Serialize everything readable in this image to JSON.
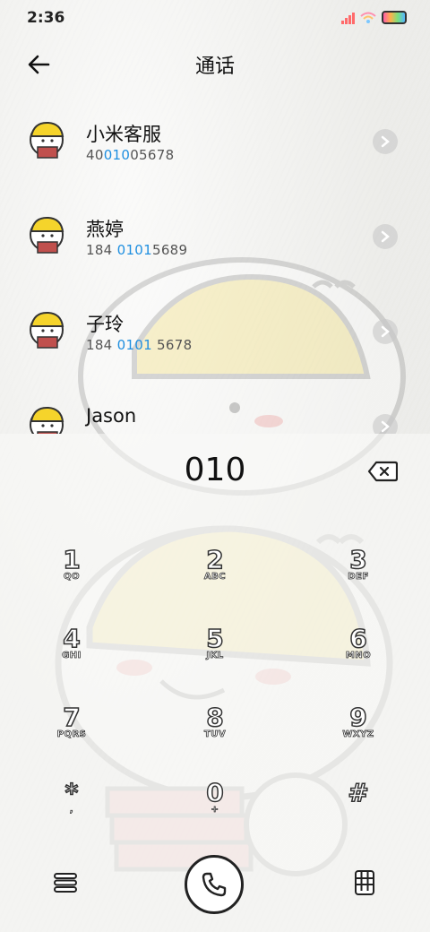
{
  "status": {
    "time": "2:36"
  },
  "header": {
    "title": "通话"
  },
  "contacts": [
    {
      "name": "小米客服",
      "num_pre": "40",
      "num_hl": "010",
      "num_post": "05678"
    },
    {
      "name": "燕婷",
      "num_pre": "184 ",
      "num_hl": "0101",
      "num_post": "5689"
    },
    {
      "name": "子玲",
      "num_pre": "184 ",
      "num_hl": "0101",
      "num_post": " 5678"
    },
    {
      "name": "Jason",
      "num_pre": "",
      "num_hl": "",
      "num_post": ""
    }
  ],
  "dialer": {
    "input": "010",
    "keys": [
      {
        "digit": "1",
        "letters": "QO"
      },
      {
        "digit": "2",
        "letters": "ABC"
      },
      {
        "digit": "3",
        "letters": "DEF"
      },
      {
        "digit": "4",
        "letters": "GHI"
      },
      {
        "digit": "5",
        "letters": "JKL"
      },
      {
        "digit": "6",
        "letters": "MNO"
      },
      {
        "digit": "7",
        "letters": "PQRS"
      },
      {
        "digit": "8",
        "letters": "TUV"
      },
      {
        "digit": "9",
        "letters": "WXYZ"
      },
      {
        "digit": "*",
        "letters": ","
      },
      {
        "digit": "0",
        "letters": "+"
      },
      {
        "digit": "#",
        "letters": ""
      }
    ]
  },
  "colors": {
    "highlight": "#1f8fe0",
    "hat": "#f6e27a"
  },
  "icons": [
    "back-arrow-icon",
    "chevron-right-icon",
    "backspace-icon",
    "menu-icon",
    "phone-icon",
    "keypad-icon"
  ]
}
